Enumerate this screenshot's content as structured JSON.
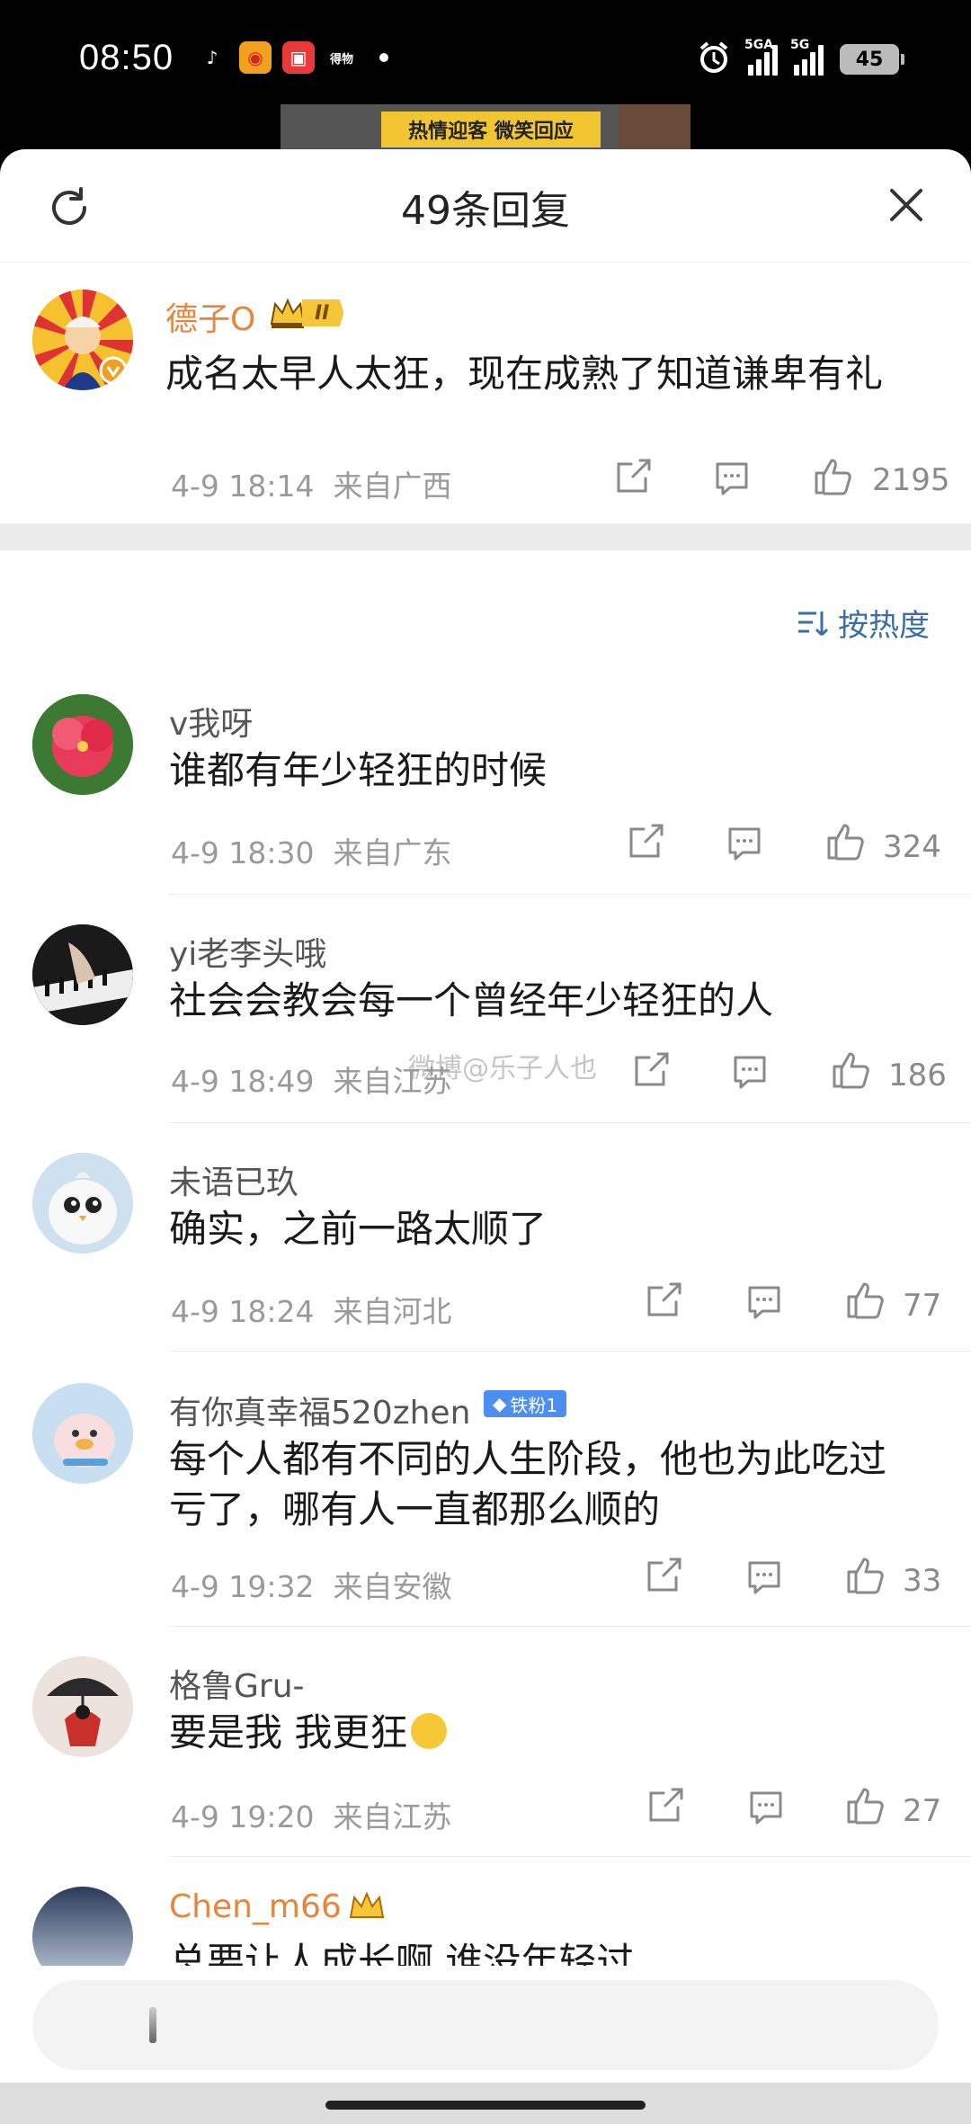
{
  "status_bar": {
    "time": "08:50",
    "app_icons": [
      "tiktok-icon",
      "weibo-icon",
      "xiaohongshu-icon",
      "dewu-icon"
    ],
    "app_icon_text": {
      "dewu": "得物"
    },
    "net1": "5GA",
    "net2": "5G",
    "battery": "45"
  },
  "video": {
    "caption": "热情迎客 微笑回应"
  },
  "sheet": {
    "title": "49条回复"
  },
  "main_comment": {
    "username": "德子O",
    "vip_level": "II",
    "text": "成名太早人太狂，现在成熟了知道谦卑有礼",
    "time": "4-9 18:14",
    "location": "来自广西",
    "likes": "2195"
  },
  "sort_label": "按热度",
  "replies": [
    {
      "username": "v我呀",
      "text": "谁都有年少轻狂的时候",
      "time": "4-9 18:30",
      "location": "来自广东",
      "likes": "324"
    },
    {
      "username": "yi老李头哦",
      "text": "社会会教会每一个曾经年少轻狂的人",
      "time": "4-9 18:49",
      "location": "来自江苏",
      "likes": "186"
    },
    {
      "username": "未语已玖",
      "text": "确实，之前一路太顺了",
      "time": "4-9 18:24",
      "location": "来自河北",
      "likes": "77"
    },
    {
      "username": "有你真幸福520zhen",
      "badge": "铁粉1",
      "text_line1": "每个人都有不同的人生阶段，他也为此吃过",
      "text_line2": "亏了，哪有人一直都那么顺的",
      "time": "4-9 19:32",
      "location": "来自安徽",
      "likes": "33"
    },
    {
      "username": "格鲁Gru-",
      "text": "要是我 我更狂",
      "time": "4-9 19:20",
      "location": "来自江苏",
      "likes": "27"
    },
    {
      "username": "Chen_m66",
      "text": "总要让人成长啊 谁没年轻过"
    }
  ],
  "watermark": "微博@乐子人也",
  "colors": {
    "accent": "#3b6ea5",
    "gold_name": "#e8853a",
    "meta": "#9a9a9a"
  }
}
